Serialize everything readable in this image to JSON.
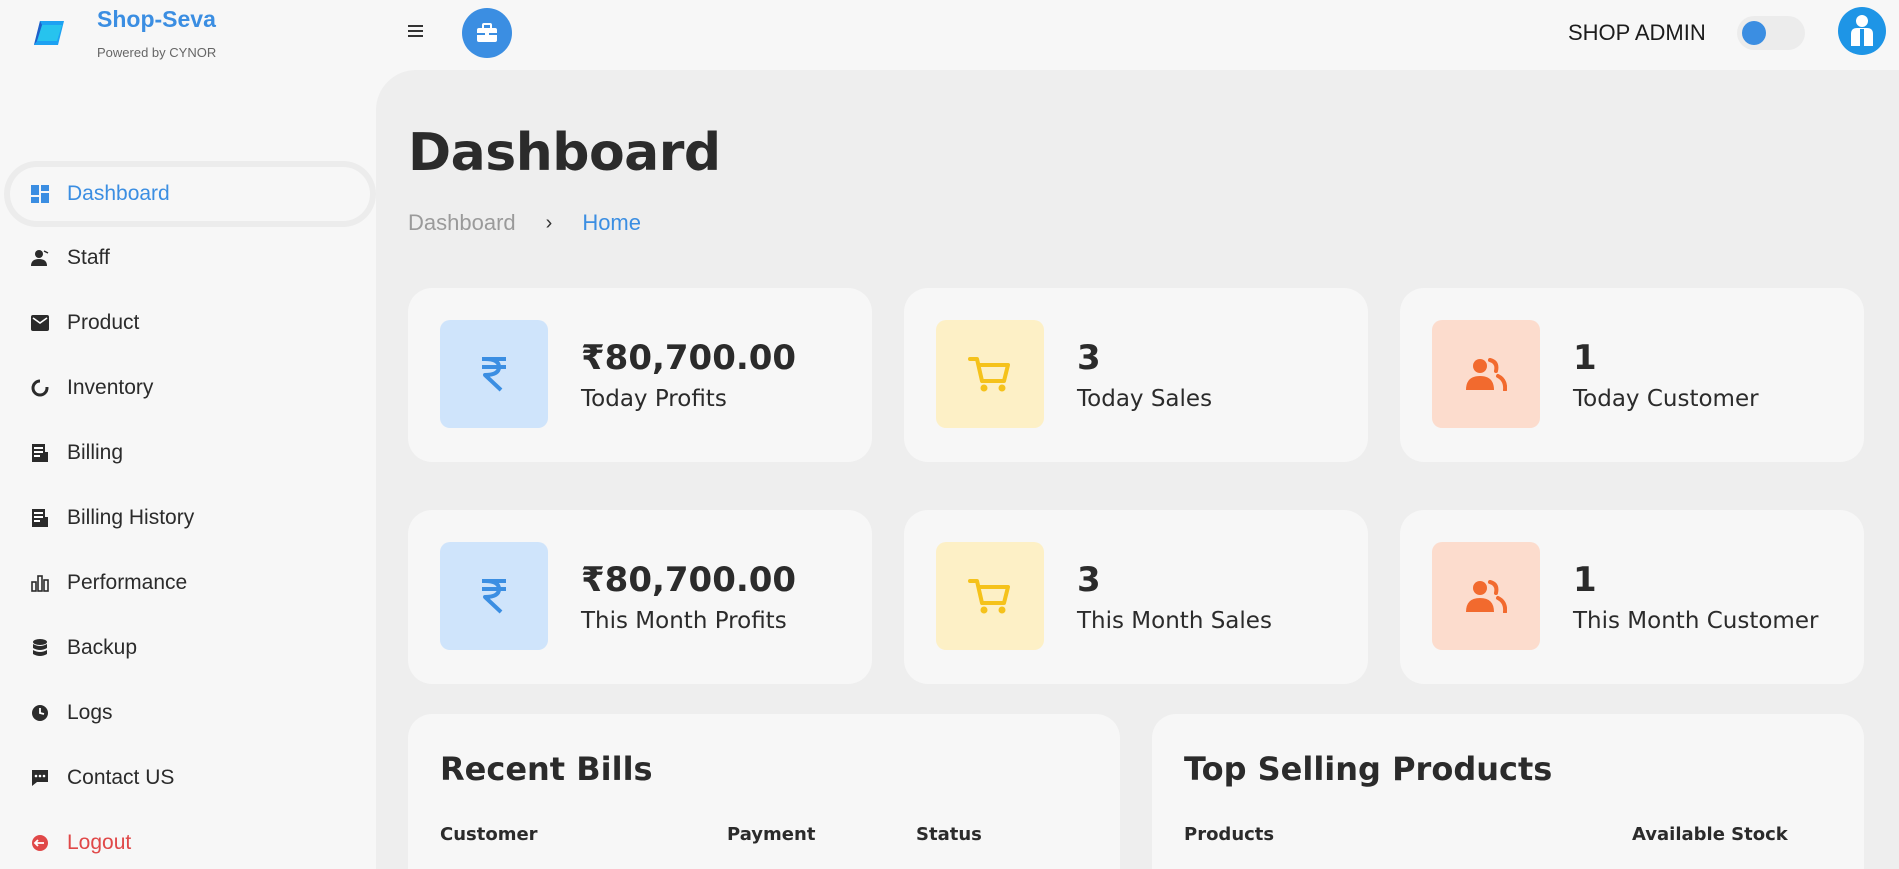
{
  "brand": {
    "name": "Shop-Seva",
    "subtitle": "Powered by CYNOR",
    "accent_color": "#3b8ee2"
  },
  "header": {
    "menu_icon": "hamburger-icon",
    "briefcase_icon": "briefcase-icon",
    "role": "SHOP ADMIN",
    "theme_toggle_icon": "toggle-icon",
    "avatar_icon": "user-icon"
  },
  "sidebar": {
    "items": [
      {
        "label": "Dashboard",
        "icon": "dashboard-icon",
        "active": true
      },
      {
        "label": "Staff",
        "icon": "user-icon"
      },
      {
        "label": "Product",
        "icon": "mail-icon"
      },
      {
        "label": "Inventory",
        "icon": "pie-icon"
      },
      {
        "label": "Billing",
        "icon": "receipt-icon"
      },
      {
        "label": "Billing History",
        "icon": "receipt-icon"
      },
      {
        "label": "Performance",
        "icon": "bar-chart-icon"
      },
      {
        "label": "Backup",
        "icon": "database-icon"
      },
      {
        "label": "Logs",
        "icon": "clock-icon"
      },
      {
        "label": "Contact US",
        "icon": "chat-icon"
      },
      {
        "label": "Logout",
        "icon": "logout-icon",
        "color": "#e04848"
      }
    ]
  },
  "main": {
    "title": "Dashboard",
    "breadcrumb": {
      "parent": "Dashboard",
      "current": "Home"
    },
    "stats": [
      {
        "value": "₹80,700.00",
        "label": "Today Profits",
        "icon": "rupee-icon",
        "color": "#3b8ee2"
      },
      {
        "value": "3",
        "label": "Today Sales",
        "icon": "cart-icon",
        "color": "#f5c21b"
      },
      {
        "value": "1",
        "label": "Today Customer",
        "icon": "users-icon",
        "color": "#f26a2e"
      },
      {
        "value": "₹80,700.00",
        "label": "This Month Profits",
        "icon": "rupee-icon",
        "color": "#3b8ee2"
      },
      {
        "value": "3",
        "label": "This Month Sales",
        "icon": "cart-icon",
        "color": "#f5c21b"
      },
      {
        "value": "1",
        "label": "This Month Customer",
        "icon": "users-icon",
        "color": "#f26a2e"
      }
    ],
    "recent_bills": {
      "title": "Recent Bills",
      "columns": [
        "Customer",
        "Payment",
        "Status"
      ]
    },
    "top_products": {
      "title": "Top Selling Products",
      "columns": [
        "Products",
        "Available Stock"
      ]
    }
  }
}
